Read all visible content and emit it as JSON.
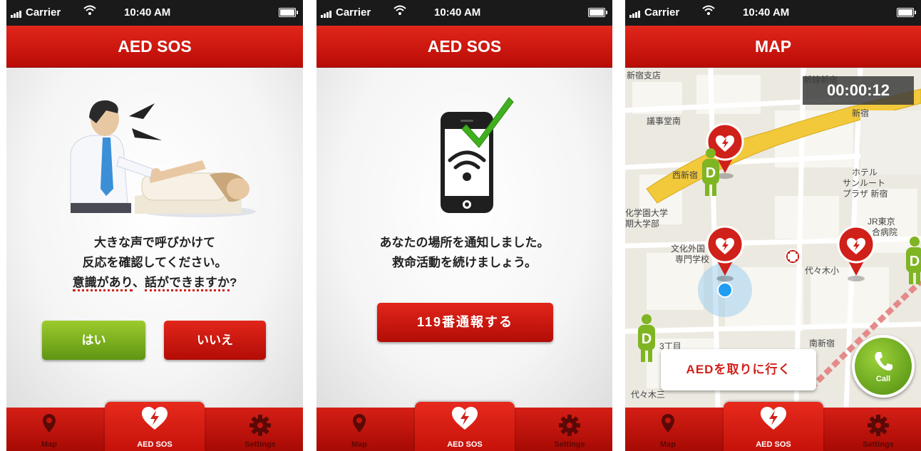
{
  "status_bar": {
    "carrier": "Carrier",
    "time": "10:40 AM"
  },
  "screen1": {
    "title": "AED SOS",
    "message": {
      "line1": "大きな声で呼びかけて",
      "line2": "反応を確認してください。",
      "q_part1": "意識があり",
      "q_sep": "、",
      "q_part2": "話ができますか",
      "q_end": "?"
    },
    "yes_label": "はい",
    "no_label": "いいえ"
  },
  "screen2": {
    "title": "AED SOS",
    "message": {
      "line1": "あなたの場所を通知しました。",
      "line2": "救命活動を続けましょう。"
    },
    "call_119_label": "119番通報する"
  },
  "screen3": {
    "title": "MAP",
    "timer": "00:00:12",
    "aed_fetch_label": "AEDを取りに行く",
    "call_label": "Call",
    "map_labels": {
      "shinjuku_branch": "新宿支店",
      "gijidomae": "議事堂南",
      "nishishinjuku": "西新宿",
      "shinjuku": "新宿",
      "hotel1": "ホテル",
      "hotel2": "サンルート",
      "hotel3": "プラザ 新宿",
      "jr_hospital1": "JR東京",
      "jr_hospital2": "合病院",
      "univ1": "化学園大学",
      "univ2": "期大学部",
      "bunka1": "文化外国",
      "bunka2": "専門学校",
      "yoyogi_elem": "代々木小",
      "minami_shinjuku": "南新宿",
      "sanchome": "3丁目",
      "yoyogi3": "代々木三",
      "shinsen": "新線新宿"
    }
  },
  "tabs": {
    "map": "Map",
    "sos": "AED SOS",
    "settings": "Settings"
  },
  "colors": {
    "brand_red": "#d0201a",
    "accent_green": "#7fb522"
  },
  "icons": [
    "signal-icon",
    "wifi-icon",
    "battery-icon",
    "map-pin-icon",
    "heart-bolt-icon",
    "gear-icon",
    "smartphone-wifi-icon",
    "checkmark-icon",
    "phone-icon",
    "location-dot-icon",
    "aed-marker-icon",
    "person-d-icon",
    "hospital-cross-icon"
  ]
}
